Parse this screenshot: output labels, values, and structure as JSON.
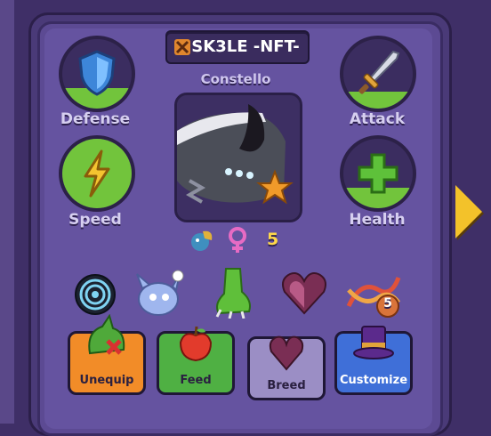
{
  "nft": {
    "title": "SK3LE -NFT-",
    "name": "Constello",
    "breed_count": "5"
  },
  "stats": {
    "defense": {
      "label": "Defense",
      "level": 0.3,
      "icon": "shield-icon"
    },
    "attack": {
      "label": "Attack",
      "level": 0.25,
      "icon": "sword-icon"
    },
    "speed": {
      "label": "Speed",
      "level": 1.0,
      "icon": "lightning-icon"
    },
    "health": {
      "label": "Health",
      "level": 0.3,
      "icon": "plus-icon"
    }
  },
  "inventory": {
    "dna_badge": "5"
  },
  "actions": {
    "unequip": "Unequip",
    "feed": "Feed",
    "breed": "Breed",
    "customize": "Customize"
  },
  "colors": {
    "stat_fill": "#72c43c",
    "accent_yellow": "#f3c22a",
    "unequip_btn": "#f28c28",
    "feed_btn": "#4fb043",
    "breed_btn": "#9b8ec5",
    "customize_btn": "#3f6fd8"
  }
}
